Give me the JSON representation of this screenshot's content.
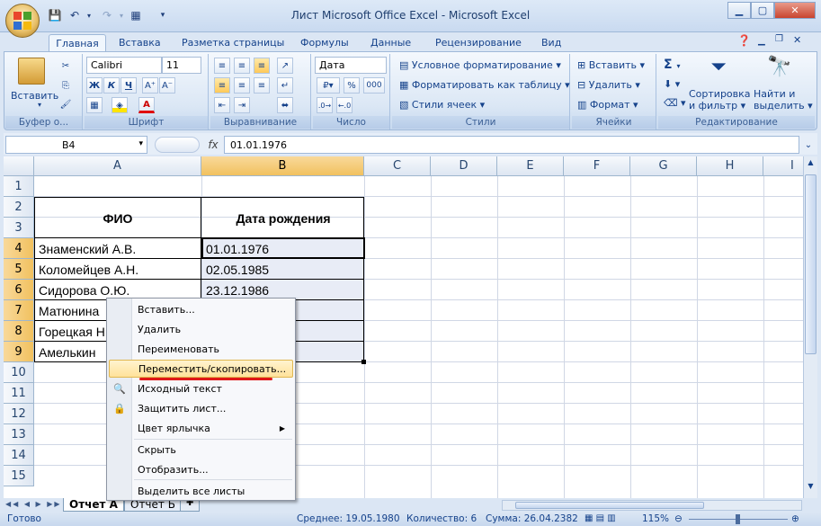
{
  "window": {
    "title": "Лист Microsoft Office Excel - Microsoft Excel"
  },
  "tabs": [
    "Главная",
    "Вставка",
    "Разметка страницы",
    "Формулы",
    "Данные",
    "Рецензирование",
    "Вид"
  ],
  "ribbon": {
    "clipboard": {
      "label": "Буфер о...",
      "paste": "Вставить"
    },
    "font": {
      "label": "Шрифт",
      "name": "Calibri",
      "size": "11",
      "bold": "Ж",
      "italic": "К",
      "underline": "Ч"
    },
    "alignment": {
      "label": "Выравнивание"
    },
    "number": {
      "label": "Число",
      "format": "Дата",
      "percent": "%",
      "thousands": "000"
    },
    "styles": {
      "label": "Стили",
      "conditional": "Условное форматирование",
      "as_table": "Форматировать как таблицу",
      "cell_styles": "Стили ячеек"
    },
    "cells": {
      "label": "Ячейки",
      "insert": "Вставить",
      "delete": "Удалить",
      "format": "Формат"
    },
    "editing": {
      "label": "Редактирование",
      "sum": "Σ",
      "sort1": "Сортировка",
      "sort2": "и фильтр",
      "find1": "Найти и",
      "find2": "выделить"
    }
  },
  "formula_bar": {
    "name_box": "B4",
    "fx": "fx",
    "value": "01.01.1976"
  },
  "columns": [
    "A",
    "B",
    "C",
    "D",
    "E",
    "F",
    "G",
    "H",
    "I"
  ],
  "rows": [
    "1",
    "2",
    "3",
    "4",
    "5",
    "6",
    "7",
    "8",
    "9",
    "10",
    "11",
    "12",
    "13",
    "14",
    "15"
  ],
  "cells": {
    "header_a": "ФИО",
    "header_b": "Дата рождения",
    "a4": "Знаменский А.В.",
    "b4": "01.01.1976",
    "a5": "Коломейцев А.Н.",
    "b5": "02.05.1985",
    "a6": "Сидорова О.Ю.",
    "b6": "23.12.1986",
    "a7": "Матюнина",
    "a8": "Горецкая Н",
    "a9": "Амелькин"
  },
  "context_menu": {
    "items": [
      "Вставить...",
      "Удалить",
      "Переименовать",
      "Переместить/скопировать...",
      "Исходный текст",
      "Защитить лист...",
      "Цвет ярлычка",
      "Скрыть",
      "Отобразить...",
      "Выделить все листы"
    ]
  },
  "sheets": [
    "Отчет А",
    "Отчет Б"
  ],
  "status": {
    "ready": "Готово",
    "average": "Среднее: 19.05.1980",
    "count": "Количество: 6",
    "sum": "Сумма: 26.04.2382",
    "zoom": "115%"
  },
  "colors": {
    "accent": "#15428b",
    "selection": "#f1c15f",
    "highlight_line": "#e01818"
  }
}
